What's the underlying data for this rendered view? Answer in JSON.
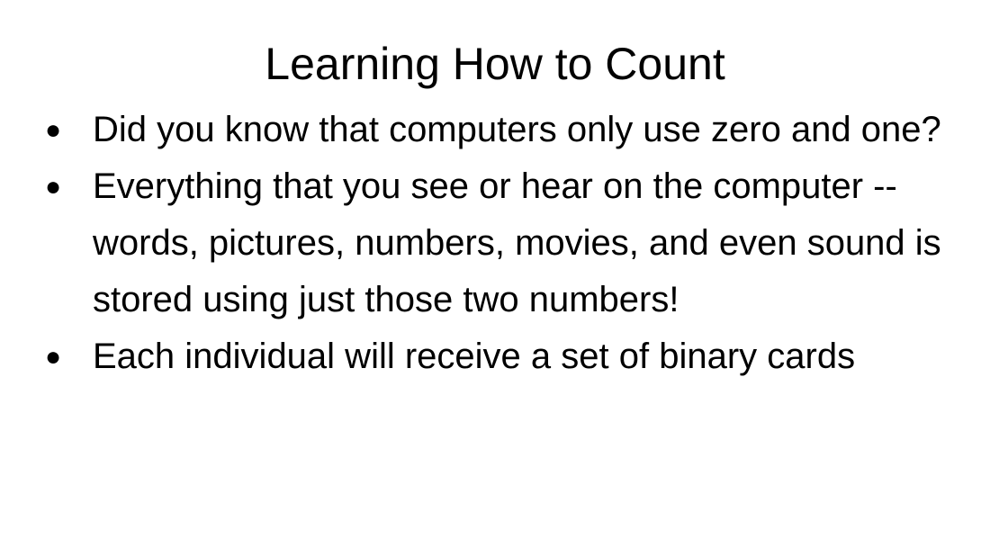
{
  "slide": {
    "title": "Learning How to Count",
    "bullet_glyph": "●",
    "bullets": [
      {
        "text": "Did you know that computers only use zero and one?"
      },
      {
        "text": "Everything that you see or hear on the computer -- words, pictures, numbers, movies, and even sound is stored using just those two numbers!"
      },
      {
        "text": "Each individual will receive a set of binary cards"
      }
    ]
  }
}
